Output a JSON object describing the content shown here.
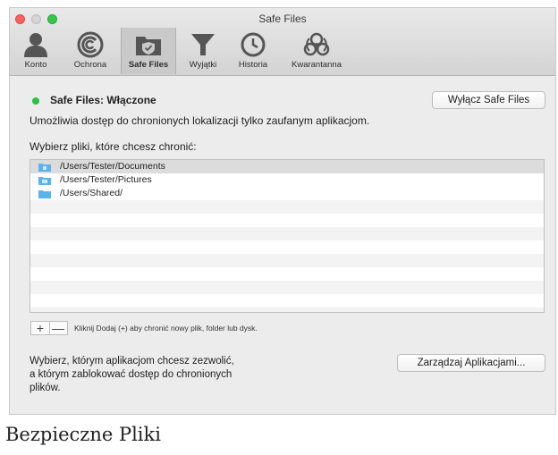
{
  "window": {
    "title": "Safe Files"
  },
  "toolbar": {
    "tabs": [
      {
        "label": "Konto",
        "icon": "person-icon"
      },
      {
        "label": "Ochrona",
        "icon": "protection-icon"
      },
      {
        "label": "Safe Files",
        "icon": "safe-files-icon",
        "active": true
      },
      {
        "label": "Wyjątki",
        "icon": "funnel-icon"
      },
      {
        "label": "Historia",
        "icon": "clock-icon"
      },
      {
        "label": "Kwarantanna",
        "icon": "biohazard-icon"
      }
    ]
  },
  "status": {
    "text": "Safe Files: Włączone",
    "color": "#2cc13f"
  },
  "buttons": {
    "disable": "Wyłącz Safe Files",
    "manage": "Zarządzaj Aplikacjami..."
  },
  "description": "Umożliwia dostęp do chronionych lokalizacji tylko zaufanym aplikacjom.",
  "choose_label": "Wybierz pliki, które chcesz chronić:",
  "files": [
    {
      "path": "/Users/Tester/Documents",
      "icon": "folder-documents-icon"
    },
    {
      "path": "/Users/Tester/Pictures",
      "icon": "folder-pictures-icon"
    },
    {
      "path": "/Users/Shared/",
      "icon": "folder-icon"
    }
  ],
  "controls": {
    "plus": "+",
    "minus": "—"
  },
  "hint": "Kliknij Dodaj (+) aby chronić nowy plik, folder lub dysk.",
  "apps_text": [
    "Wybierz, którym aplikacjom chcesz zezwolić,",
    "a którym zablokować dostęp do chronionych",
    "plików."
  ],
  "caption": "Bezpieczne Pliki"
}
